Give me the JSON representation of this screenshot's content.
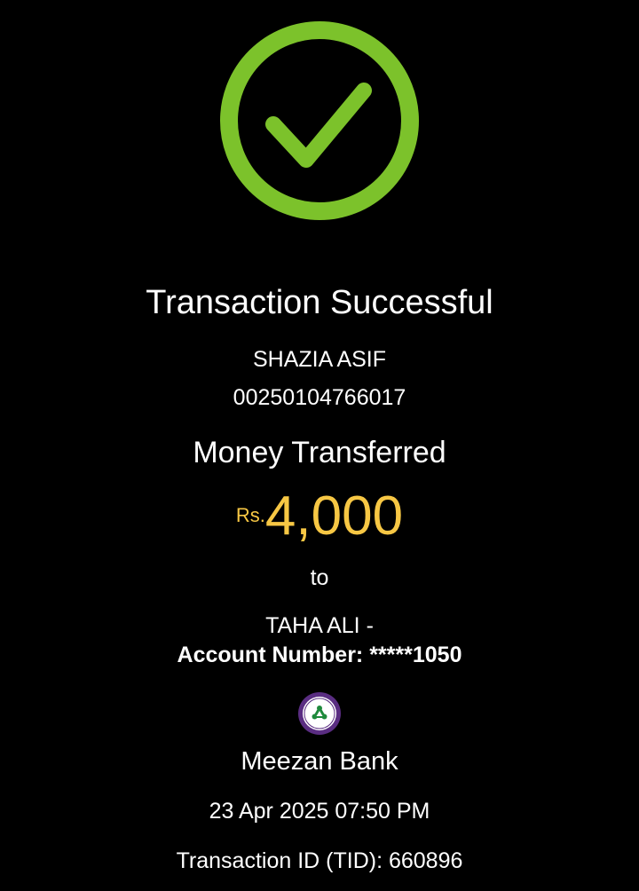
{
  "colors": {
    "background": "#000000",
    "success_green": "#7cc22b",
    "amount_yellow": "#f7c744",
    "text": "#ffffff",
    "bank_purple": "#5a2d82"
  },
  "status_icon": "check-circle-icon",
  "title": "Transaction Successful",
  "sender": {
    "name": "SHAZIA ASIF",
    "account": "00250104766017"
  },
  "transfer": {
    "label": "Money Transferred",
    "currency": "Rs.",
    "amount": "4,000",
    "to_label": "to"
  },
  "recipient": {
    "name": "TAHA ALI -",
    "account_label": "Account Number: *****1050"
  },
  "bank": {
    "logo_icon": "meezan-bank-logo-icon",
    "name": "Meezan Bank"
  },
  "datetime": "23 Apr 2025 07:50 PM",
  "transaction_id": "Transaction ID (TID): 660896"
}
